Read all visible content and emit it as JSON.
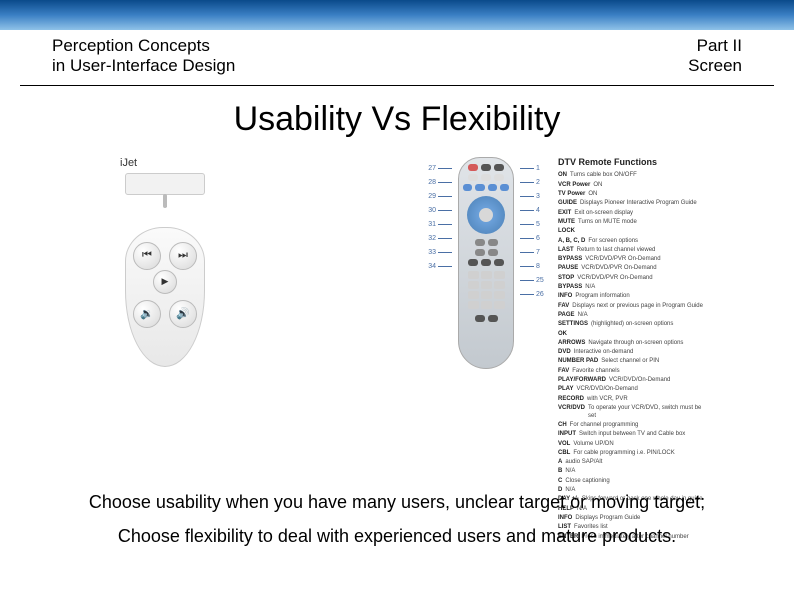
{
  "header": {
    "left_line1": "Perception Concepts",
    "left_line2": "in User-Interface Design",
    "right_line1": "Part II",
    "right_line2": "Screen"
  },
  "title": "Usability Vs Flexibility",
  "simple_remote": {
    "brand": "iJet",
    "buttons": {
      "prev": "⏮",
      "next": "⏭",
      "vol_up": "🔊",
      "vol_down": "🔉",
      "play": "▶"
    }
  },
  "complex_remote": {
    "left_callouts": [
      "27",
      "28",
      "29",
      "30",
      "31",
      "32",
      "33",
      "34"
    ],
    "right_callouts": [
      "1",
      "2",
      "3",
      "4",
      "5",
      "6",
      "7",
      "8",
      "25",
      "26"
    ],
    "functions_title": "DTV Remote Functions",
    "functions": [
      {
        "k": "ON",
        "v": "Turns cable box ON/OFF"
      },
      {
        "k": "VCR Power",
        "v": "ON"
      },
      {
        "k": "TV Power",
        "v": "ON"
      },
      {
        "k": "GUIDE",
        "v": "Displays Pioneer Interactive Program Guide"
      },
      {
        "k": "EXIT",
        "v": "Exit on-screen display"
      },
      {
        "k": "MUTE",
        "v": "Turns on MUTE mode"
      },
      {
        "k": "LOCK",
        "v": ""
      },
      {
        "k": "A, B, C, D",
        "v": "For screen options"
      },
      {
        "k": "LAST",
        "v": "Return to last channel viewed"
      },
      {
        "k": "BYPASS",
        "v": "VCR/DVD/PVR On-Demand"
      },
      {
        "k": "PAUSE",
        "v": "VCR/DVD/PVR On-Demand"
      },
      {
        "k": "STOP",
        "v": "VCR/DVD/PVR On-Demand"
      },
      {
        "k": "BYPASS",
        "v": "N/A"
      },
      {
        "k": "INFO",
        "v": "Program information"
      },
      {
        "k": "FAV",
        "v": "Displays next or previous page in Program Guide"
      },
      {
        "k": "PAGE",
        "v": "N/A"
      },
      {
        "k": "SETTINGS",
        "v": "(highlighted) on-screen options"
      },
      {
        "k": "OK",
        "v": ""
      },
      {
        "k": "ARROWS",
        "v": "Navigate through on-screen options"
      },
      {
        "k": "DVD",
        "v": "Interactive on-demand"
      },
      {
        "k": "NUMBER PAD",
        "v": "Select channel or PIN"
      },
      {
        "k": "FAV",
        "v": "Favorite channels"
      },
      {
        "k": "PLAY/FORWARD",
        "v": "VCR/DVD/On-Demand"
      },
      {
        "k": "PLAY",
        "v": "VCR/DVD/On-Demand"
      },
      {
        "k": "RECORD",
        "v": "with VCR, PVR"
      },
      {
        "k": "VCR/DVD",
        "v": "To operate your VCR/DVD, switch must be set"
      },
      {
        "k": "CH",
        "v": "For channel programming"
      },
      {
        "k": "INPUT",
        "v": "Switch input between TV and Cable box"
      },
      {
        "k": "VOL",
        "v": "Volume UP/DN"
      },
      {
        "k": "CBL",
        "v": "For cable programming i.e. PIN/LOCK"
      },
      {
        "k": "A",
        "v": "audio SAP/Alt"
      },
      {
        "k": "B",
        "v": "N/A"
      },
      {
        "k": "C",
        "v": "Close captioning"
      },
      {
        "k": "D",
        "v": "N/A"
      },
      {
        "k": "DAY +/-",
        "v": "Skips forward or back one whole day in guide"
      },
      {
        "k": "HELP",
        "v": "N/A"
      },
      {
        "k": "INFO",
        "v": "Displays Program Guide"
      },
      {
        "k": "LIST",
        "v": "Favorites list"
      },
      {
        "k": "ENTER",
        "v": "Press immediately after channel number"
      }
    ]
  },
  "bottom": {
    "line1": "Choose usability when you have many users, unclear target or moving target;",
    "line2": "Choose flexibility to deal with experienced users and mature products."
  }
}
